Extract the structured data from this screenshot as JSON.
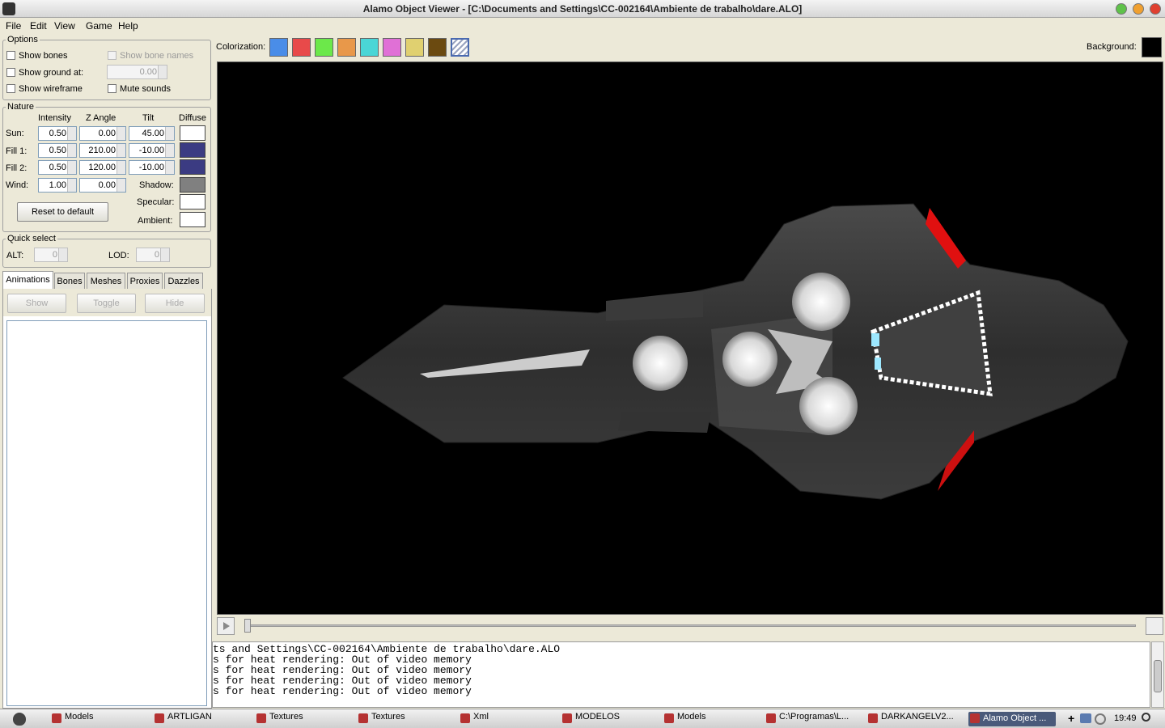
{
  "window": {
    "title": "Alamo Object Viewer - [C:\\Documents and Settings\\CC-002164\\Ambiente de trabalho\\dare.ALO]"
  },
  "menu": [
    "File",
    "Edit",
    "View",
    "Game",
    "Help"
  ],
  "options": {
    "group_label": "Options",
    "show_bones": "Show bones",
    "show_bone_names": "Show bone names",
    "show_ground": "Show ground at:",
    "ground_value": "0.00",
    "show_wireframe": "Show wireframe",
    "mute_sounds": "Mute sounds"
  },
  "nature": {
    "group_label": "Nature",
    "headers": {
      "intensity": "Intensity",
      "zangle": "Z Angle",
      "tilt": "Tilt",
      "diffuse": "Diffuse"
    },
    "rows": [
      {
        "label": "Sun:",
        "intensity": "0.50",
        "zangle": "0.00",
        "tilt": "45.00",
        "color": "#ffffff"
      },
      {
        "label": "Fill 1:",
        "intensity": "0.50",
        "zangle": "210.00",
        "tilt": "-10.00",
        "color": "#3b3b82"
      },
      {
        "label": "Fill 2:",
        "intensity": "0.50",
        "zangle": "120.00",
        "tilt": "-10.00",
        "color": "#3b3b82"
      },
      {
        "label": "Wind:",
        "intensity": "1.00",
        "zangle": "0.00"
      }
    ],
    "shadow_label": "Shadow:",
    "shadow_color": "#808080",
    "specular_label": "Specular:",
    "specular_color": "#ffffff",
    "ambient_label": "Ambient:",
    "ambient_color": "#ffffff",
    "reset_button": "Reset to default"
  },
  "quick_select": {
    "group_label": "Quick select",
    "alt_label": "ALT:",
    "alt_value": "0",
    "lod_label": "LOD:",
    "lod_value": "0"
  },
  "tabs": [
    "Animations",
    "Bones",
    "Meshes",
    "Proxies",
    "Dazzles"
  ],
  "anim_buttons": {
    "show": "Show",
    "toggle": "Toggle",
    "hide": "Hide"
  },
  "colorization": {
    "label": "Colorization:",
    "colors": [
      "#4a8de8",
      "#e84a4a",
      "#6ce84a",
      "#e8984a",
      "#4ad6d6",
      "#e070d6",
      "#e0d070",
      "#6b4a10"
    ]
  },
  "background": {
    "label": "Background:",
    "color": "#000000"
  },
  "console": [
    "ts and Settings\\CC-002164\\Ambiente de trabalho\\dare.ALO",
    "s for heat rendering: Out of video memory",
    "s for heat rendering: Out of video memory",
    "s for heat rendering: Out of video memory",
    "s for heat rendering: Out of video memory"
  ],
  "taskbar": {
    "items": [
      "Models",
      "ARTLIGAN",
      "Textures",
      "Textures",
      "Xml",
      "MODELOS",
      "Models",
      "C:\\Programas\\L...",
      "DARKANGELV2...",
      "Alamo Object ..."
    ],
    "clock": "19:49"
  }
}
